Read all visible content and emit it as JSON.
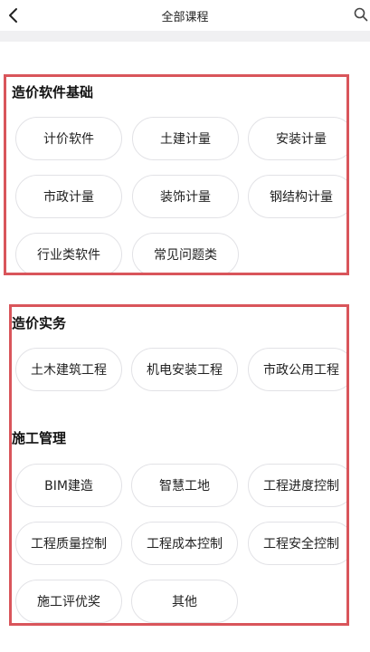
{
  "header": {
    "title": "全部课程"
  },
  "groups": [
    {
      "title": "造价软件基础",
      "items": [
        "计价软件",
        "土建计量",
        "安装计量",
        "市政计量",
        "装饰计量",
        "钢结构计量",
        "行业类软件",
        "常见问题类"
      ]
    },
    {
      "title": "造价实务",
      "items": [
        "土木建筑工程",
        "机电安装工程",
        "市政公用工程"
      ]
    },
    {
      "title": "施工管理",
      "items": [
        "BIM建造",
        "智慧工地",
        "工程进度控制",
        "工程质量控制",
        "工程成本控制",
        "工程安全控制",
        "施工评优奖",
        "其他"
      ]
    }
  ],
  "colors": {
    "highlight_border": "#d9555b",
    "chip_border": "#e2e2e6",
    "strip": "#f0f0f2"
  }
}
